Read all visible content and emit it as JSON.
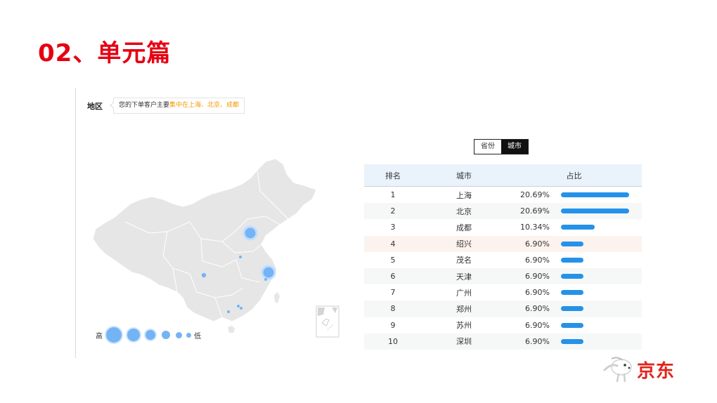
{
  "slide": {
    "title": "02、单元篇"
  },
  "region": {
    "label": "地区",
    "tip_prefix": "您的下单客户主要",
    "tip_highlight": "集中在上海、北京、成都"
  },
  "legend": {
    "high": "高",
    "low": "低"
  },
  "toggle": {
    "province": "省份",
    "city": "城市",
    "active": "city"
  },
  "table": {
    "headers": {
      "rank": "排名",
      "city": "城市",
      "share": "占比"
    },
    "rows": [
      {
        "rank": "1",
        "city": "上海",
        "share": "20.69%",
        "value": 20.69
      },
      {
        "rank": "2",
        "city": "北京",
        "share": "20.69%",
        "value": 20.69
      },
      {
        "rank": "3",
        "city": "成都",
        "share": "10.34%",
        "value": 10.34
      },
      {
        "rank": "4",
        "city": "绍兴",
        "share": "6.90%",
        "value": 6.9
      },
      {
        "rank": "5",
        "city": "茂名",
        "share": "6.90%",
        "value": 6.9
      },
      {
        "rank": "6",
        "city": "天津",
        "share": "6.90%",
        "value": 6.9
      },
      {
        "rank": "7",
        "city": "广州",
        "share": "6.90%",
        "value": 6.9
      },
      {
        "rank": "8",
        "city": "郑州",
        "share": "6.90%",
        "value": 6.9
      },
      {
        "rank": "9",
        "city": "苏州",
        "share": "6.90%",
        "value": 6.9
      },
      {
        "rank": "10",
        "city": "深圳",
        "share": "6.90%",
        "value": 6.9
      }
    ],
    "highlighted_rank": "4"
  },
  "colors": {
    "title": "#e60012",
    "bar": "#2592e9",
    "map_fill": "#e5e5e5",
    "bubble": "#74b4f5",
    "logo": "#e1251b"
  },
  "brand": {
    "name": "京东"
  }
}
